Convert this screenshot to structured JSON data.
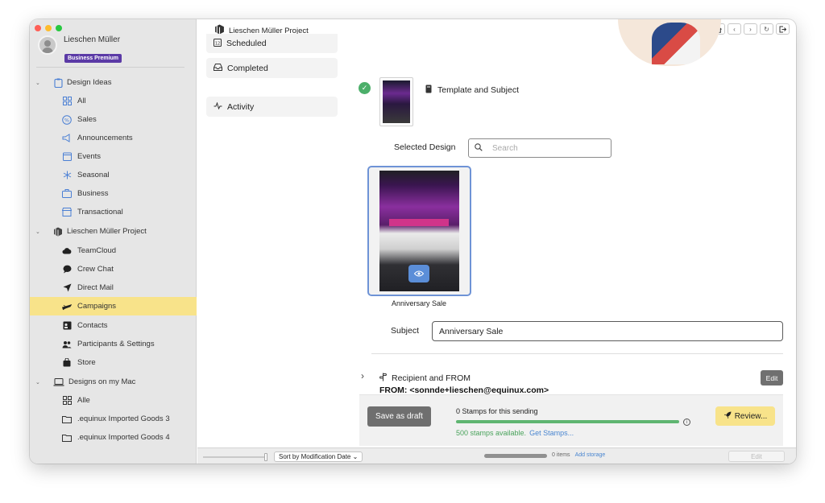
{
  "window": {
    "title": "Lieschen Müller Project"
  },
  "user": {
    "name": "Lieschen Müller",
    "plan": "Business Premium"
  },
  "sidebar": {
    "sections": [
      {
        "label": "Design Ideas",
        "icon": "clipboard-icon"
      },
      {
        "label": "Lieschen Müller Project",
        "icon": "cube-icon"
      },
      {
        "label": "Designs on my Mac",
        "icon": "laptop-icon"
      }
    ],
    "design_ideas": [
      "All",
      "Sales",
      "Announcements",
      "Events",
      "Seasonal",
      "Business",
      "Transactional"
    ],
    "project_items": [
      "TeamCloud",
      "Crew Chat",
      "Direct Mail",
      "Campaigns",
      "Contacts",
      "Participants & Settings",
      "Store"
    ],
    "mac_items": [
      "Alle",
      ".equinux Imported Goods 3",
      ".equinux Imported Goods 4"
    ],
    "active": "Campaigns"
  },
  "middle": {
    "items": [
      "Scheduled",
      "Completed",
      "Activity"
    ]
  },
  "main": {
    "template_subject_label": "Template and Subject",
    "selected_design_label": "Selected Design",
    "search_placeholder": "Search",
    "design_name": "Anniversary Sale",
    "subject_label": "Subject",
    "subject_value": "Anniversary Sale",
    "recipient_label": "Recipient and FROM",
    "from_text": "FROM: <sonnde+lieschen@equinux.com>",
    "edit_label": "Edit",
    "save_draft_label": "Save as draft",
    "stamps_text": "0 Stamps for this sending",
    "stamps_available": "500 stamps available.",
    "get_stamps": "Get Stamps...",
    "review_label": "Review...",
    "stamps_progress_fraction": 1.0
  },
  "statusbar": {
    "sort_label": "Sort by Modification Date",
    "items_text": "0 items",
    "add_storage": "Add storage",
    "edit_label": "Edit",
    "storage_fraction": 1.0
  },
  "colors": {
    "accent_yellow": "#f8e38a",
    "badge_purple": "#5b3aa6",
    "success_green": "#4caf6a",
    "link_blue": "#4a86d0"
  }
}
